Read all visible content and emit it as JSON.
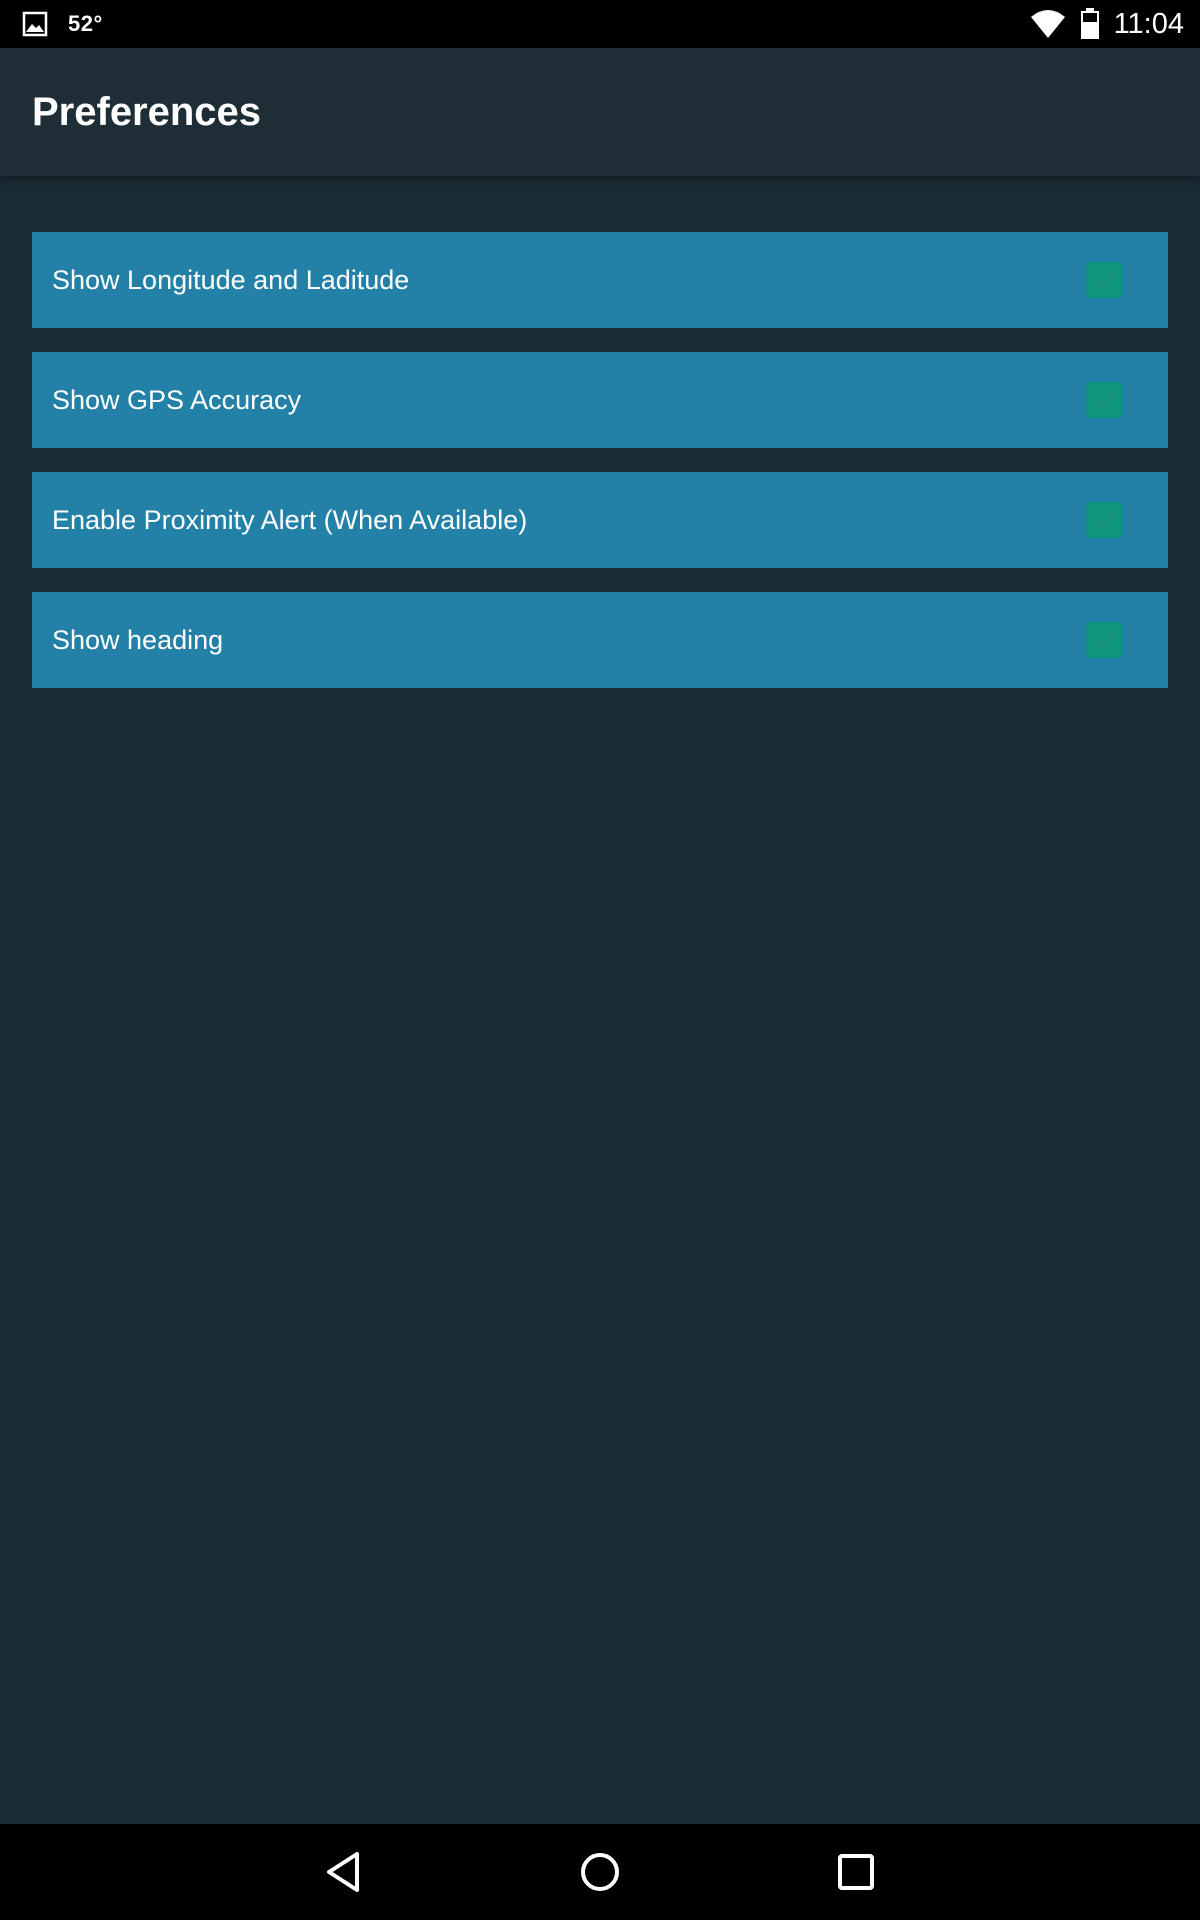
{
  "status_bar": {
    "temperature": "52°",
    "time": "11:04",
    "icons": [
      "gallery-icon",
      "wifi-icon",
      "battery-icon"
    ]
  },
  "app_bar": {
    "title": "Preferences"
  },
  "preferences": [
    {
      "label": "Show Longitude and Laditude",
      "checked": true
    },
    {
      "label": "Show GPS Accuracy",
      "checked": true
    },
    {
      "label": "Enable Proximity Alert (When Available)",
      "checked": true
    },
    {
      "label": "Show heading",
      "checked": true
    }
  ],
  "nav_bar": {
    "icons": [
      "back-icon",
      "home-icon",
      "recents-icon"
    ]
  },
  "colors": {
    "background": "#1c2c35",
    "app_bar": "#1e2d36",
    "item_background": "#2380a6",
    "checkbox": "#10967c",
    "system_bars": "#000000"
  }
}
